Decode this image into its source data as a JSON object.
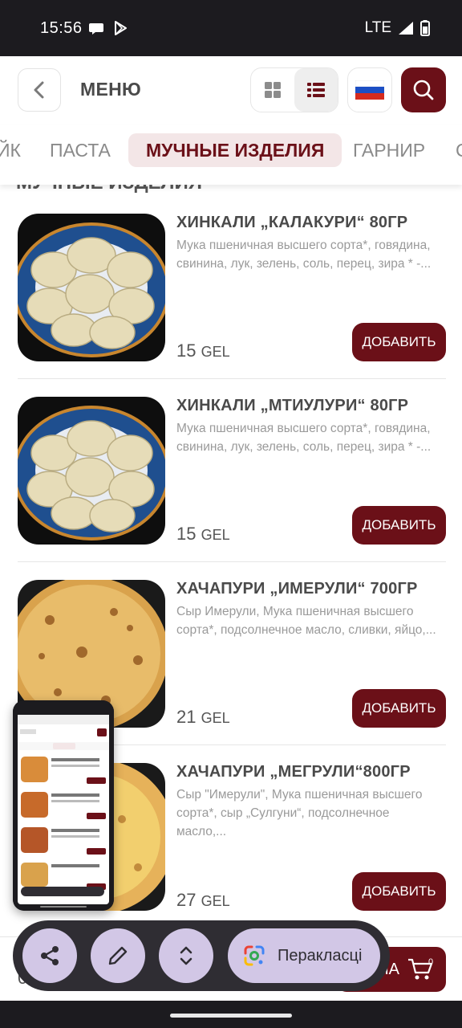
{
  "status_bar": {
    "time": "15:56",
    "network": "LTE"
  },
  "header": {
    "title": "МЕНЮ",
    "icons": {
      "back": "chevron-left-icon",
      "grid": "grid-view-icon",
      "list": "list-view-icon",
      "flag": "russia-flag-icon",
      "search": "search-icon"
    }
  },
  "categories": {
    "items": [
      "ЙК",
      "ПАСТА",
      "МУЧНЫЕ ИЗДЕЛИЯ",
      "ГАРНИР"
    ],
    "active_index": 2
  },
  "section_title": "МУЧНЫЕ ИЗДЕЛИЯ",
  "products": [
    {
      "name": "ХИНКАЛИ „КАЛАКУРИ“ 80ГР",
      "description": "Мука пшеничная высшего сорта*, говядина, свинина, лук, зелень, соль, перец, зира * -...",
      "price": "15",
      "currency": "GEL",
      "button": "ДОБАВИТЬ"
    },
    {
      "name": "ХИНКАЛИ „МТИУЛУРИ“ 80ГР",
      "description": "Мука пшеничная высшего сорта*, говядина, свинина, лук, зелень, соль, перец, зира * -...",
      "price": "15",
      "currency": "GEL",
      "button": "ДОБАВИТЬ"
    },
    {
      "name": "ХАЧАПУРИ „ИМЕРУЛИ“ 700ГР",
      "description": "Сыр Имерули, Мука пшеничная высшего сорта*, подсолнечное масло, сливки, яйцо,...",
      "price": "21",
      "currency": "GEL",
      "button": "ДОБАВИТЬ"
    },
    {
      "name": "ХАЧАПУРИ „МЕГРУЛИ“800ГР",
      "description": "Сыр \"Имерули\", Мука пшеничная высшего сорта*, сыр „Сулгуни“, подсолнечное масло,...",
      "price": "27",
      "currency": "GEL",
      "button": "ДОБАВИТЬ"
    }
  ],
  "cart": {
    "total": "0",
    "label_tail": "НА",
    "count": "0"
  },
  "action_bar": {
    "translate_label": "Перакласці",
    "icons": [
      "share-icon",
      "edit-icon",
      "expand-icon",
      "google-lens-icon"
    ]
  },
  "colors": {
    "brand": "#6b1018",
    "brand_light": "#f3e6e7",
    "action_chip": "#d2c7e6"
  }
}
